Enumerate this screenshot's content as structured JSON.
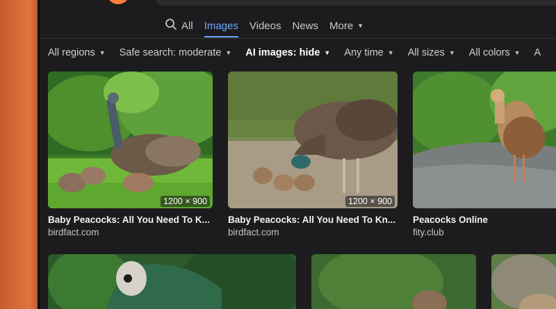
{
  "tabs": [
    {
      "label": "All",
      "icon": "search-icon"
    },
    {
      "label": "Images",
      "active": true
    },
    {
      "label": "Videos"
    },
    {
      "label": "News"
    },
    {
      "label": "More",
      "icon": "chevron-down-icon"
    }
  ],
  "filters": [
    {
      "label": "All regions"
    },
    {
      "label": "Safe search: moderate"
    },
    {
      "label": "AI images: hide",
      "bold": true
    },
    {
      "label": "Any time"
    },
    {
      "label": "All sizes"
    },
    {
      "label": "All colors"
    },
    {
      "label": "A"
    }
  ],
  "results": [
    {
      "title": "Baby Peacocks: All You Need To K...",
      "source": "birdfact.com",
      "dims": "1200 × 900"
    },
    {
      "title": "Baby Peacocks: All You Need To Kn...",
      "source": "birdfact.com",
      "dims": "1200 × 900"
    },
    {
      "title": "Peacocks Online",
      "source": "fity.club",
      "dims": ""
    }
  ],
  "colors": {
    "accent": "#6ea8ff",
    "background": "#1c1c1e",
    "logo": "#ff7b3a"
  }
}
